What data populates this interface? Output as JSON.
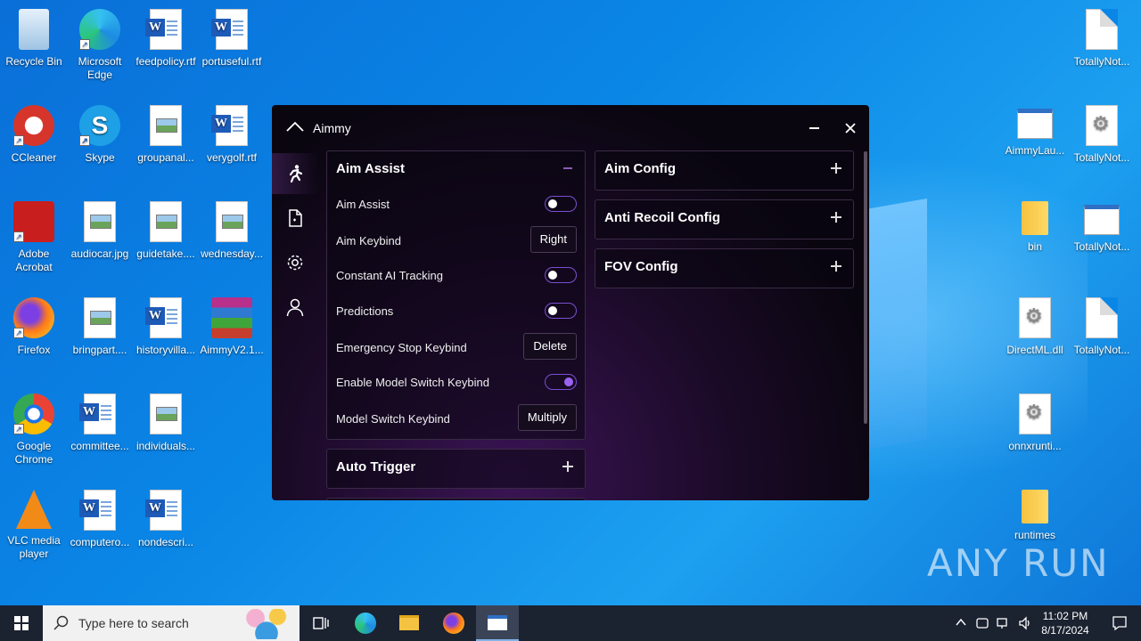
{
  "desktop": {
    "icons_left": [
      {
        "label": "Recycle Bin",
        "icon": "recycle-bin-icon"
      },
      {
        "label": "Microsoft Edge",
        "icon": "edge-icon"
      },
      {
        "label": "feedpolicy.rtf",
        "icon": "word-doc-icon"
      },
      {
        "label": "portuseful.rtf",
        "icon": "word-doc-icon"
      },
      {
        "label": "CCleaner",
        "icon": "ccleaner-icon"
      },
      {
        "label": "Skype",
        "icon": "skype-icon"
      },
      {
        "label": "groupanal...",
        "icon": "image-file-icon"
      },
      {
        "label": "verygolf.rtf",
        "icon": "word-doc-icon"
      },
      {
        "label": "Adobe Acrobat",
        "icon": "acrobat-icon"
      },
      {
        "label": "audiocar.jpg",
        "icon": "image-file-icon"
      },
      {
        "label": "guidetake....",
        "icon": "image-file-icon"
      },
      {
        "label": "wednesday...",
        "icon": "image-file-icon"
      },
      {
        "label": "Firefox",
        "icon": "firefox-icon"
      },
      {
        "label": "bringpart....",
        "icon": "image-file-icon"
      },
      {
        "label": "historyvilla...",
        "icon": "word-doc-icon"
      },
      {
        "label": "AimmyV2.1...",
        "icon": "winrar-icon"
      },
      {
        "label": "Google Chrome",
        "icon": "chrome-icon"
      },
      {
        "label": "committee...",
        "icon": "word-doc-icon"
      },
      {
        "label": "individuals...",
        "icon": "image-file-icon"
      },
      {
        "label": "VLC media player",
        "icon": "vlc-icon"
      },
      {
        "label": "computero...",
        "icon": "word-doc-icon"
      },
      {
        "label": "nondescri...",
        "icon": "word-doc-icon"
      }
    ],
    "icons_right": [
      {
        "label": "TotallyNot...",
        "icon": "blank-file-icon"
      },
      {
        "label": "AimmyLau...",
        "icon": "app-window-icon"
      },
      {
        "label": "TotallyNot...",
        "icon": "gear-file-icon"
      },
      {
        "label": "bin",
        "icon": "folder-icon"
      },
      {
        "label": "TotallyNot...",
        "icon": "app-window-icon"
      },
      {
        "label": "DirectML.dll",
        "icon": "gear-file-icon"
      },
      {
        "label": "TotallyNot...",
        "icon": "blank-file-icon"
      },
      {
        "label": "onnxrunti...",
        "icon": "gear-file-icon"
      },
      {
        "label": "runtimes",
        "icon": "folder-icon"
      }
    ],
    "watermark": "ANY RUN"
  },
  "window": {
    "title": "Aimmy",
    "nav": [
      "aim-assist-nav",
      "file-nav",
      "settings-nav",
      "user-nav"
    ],
    "aim_assist": {
      "heading": "Aim Assist",
      "rows": [
        {
          "label": "Aim Assist",
          "type": "toggle",
          "on": false
        },
        {
          "label": "Aim Keybind",
          "type": "key",
          "value": "Right"
        },
        {
          "label": "Constant AI Tracking",
          "type": "toggle",
          "on": false
        },
        {
          "label": "Predictions",
          "type": "toggle",
          "on": false
        },
        {
          "label": "Emergency Stop Keybind",
          "type": "key",
          "value": "Delete"
        },
        {
          "label": "Enable Model Switch Keybind",
          "type": "toggle",
          "on": true
        },
        {
          "label": "Model Switch Keybind",
          "type": "key",
          "value": "Multiply"
        }
      ]
    },
    "auto_trigger": {
      "heading": "Auto Trigger"
    },
    "right_panels": [
      {
        "heading": "Aim Config"
      },
      {
        "heading": "Anti Recoil Config"
      },
      {
        "heading": "FOV Config"
      }
    ]
  },
  "taskbar": {
    "search_placeholder": "Type here to search",
    "time": "11:02 PM",
    "date": "8/17/2024"
  },
  "colors": {
    "accent": "#9b62f2",
    "toggle_border": "#7a4fd0",
    "taskbar": "#1b2230"
  }
}
